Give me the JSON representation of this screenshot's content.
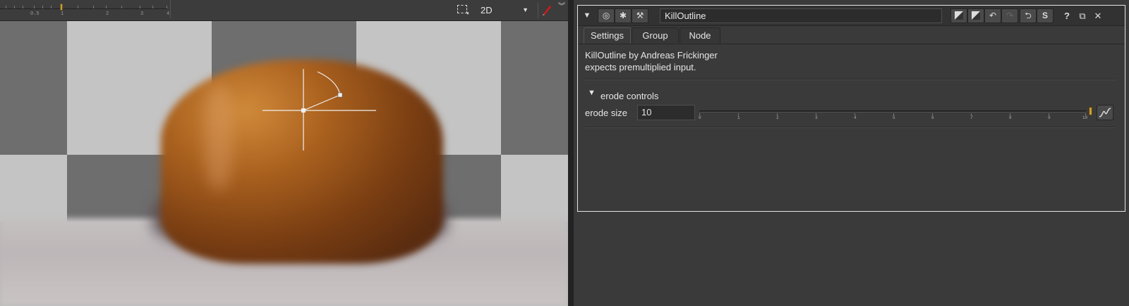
{
  "viewer": {
    "frame_ruler": {
      "labels": [
        "0.5",
        "1",
        "2",
        "3",
        "4"
      ]
    },
    "view_mode": "2D"
  },
  "panel": {
    "node_name": "KillOutline",
    "buttons": {
      "help": "?",
      "float": "⧉",
      "close": "✕",
      "s": "S"
    },
    "tabs": [
      "Settings",
      "Group",
      "Node"
    ],
    "description": [
      "KillOutline by Andreas Frickinger",
      "expects premultiplied input."
    ],
    "section_title": "erode controls",
    "erode": {
      "label": "erode size",
      "value": "10",
      "scale": [
        "0",
        "1",
        "2",
        "3",
        "4",
        "5",
        "6",
        "7",
        "8",
        "9",
        "10"
      ]
    }
  },
  "colors": {
    "accent_yellow": "#c8a03a",
    "panel_border": "#e6e6e6",
    "pen_red": "#d01a1a"
  }
}
